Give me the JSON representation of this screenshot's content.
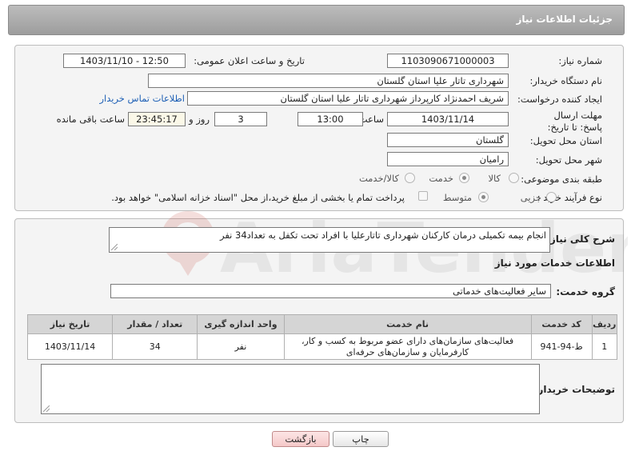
{
  "header": {
    "title": "جزئیات اطلاعات نیاز"
  },
  "form": {
    "need_number": {
      "label": "شماره نیاز:",
      "value": "1103090671000003"
    },
    "announce_datetime": {
      "label": "تاریخ و ساعت اعلان عمومی:",
      "value": "1403/11/10 - 12:50"
    },
    "buyer_org": {
      "label": "نام دستگاه خریدار:",
      "value": "شهرداری تاتار علیا استان گلستان"
    },
    "requester": {
      "label": "ایجاد کننده درخواست:",
      "value": "شریف احمدنژاد کارپرداز شهرداری تاتار علیا استان گلستان",
      "contact_link": "اطلاعات تماس خریدار"
    },
    "deadline": {
      "label": "مهلت ارسال پاسخ: تا تاریخ:",
      "date": "1403/11/14",
      "time_label": "ساعت",
      "time": "13:00",
      "days": "3",
      "days_label": "روز و",
      "remaining": "23:45:17",
      "remaining_label": "ساعت باقی مانده"
    },
    "delivery_province": {
      "label": "استان محل تحویل:",
      "value": "گلستان"
    },
    "delivery_city": {
      "label": "شهر محل تحویل:",
      "value": "رامیان"
    },
    "category": {
      "label": "طبقه بندی موضوعی:",
      "options": [
        "کالا",
        "خدمت",
        "کالا/خدمت"
      ],
      "selected": "خدمت"
    },
    "purchase_type": {
      "label": "نوع فرآیند خرید :",
      "options": [
        "جزیی",
        "متوسط"
      ],
      "selected": "متوسط",
      "checkbox_text": "پرداخت تمام یا بخشی از مبلغ خرید،از محل \"اسناد خزانه اسلامی\" خواهد بود."
    }
  },
  "description": {
    "label": "شرح کلی نیاز:",
    "value": "انجام بیمه تکمیلی درمان کارکنان شهرداری تاتارعلیا با افراد تحت تکفل به تعداد34 نفر"
  },
  "services": {
    "section_title": "اطلاعات خدمات مورد نیاز",
    "group_label": "گروه خدمت:",
    "group_value": "سایر فعالیت‌های خدماتی",
    "columns": [
      "ردیف",
      "کد خدمت",
      "نام خدمت",
      "واحد اندازه گیری",
      "تعداد / مقدار",
      "تاریخ نیاز"
    ],
    "rows": [
      [
        "1",
        "ط-94-941",
        "فعالیت‌های سازمان‌های دارای عضو مربوط به کسب و کار، کارفرمایان و سازمان‌های حرفه‌ای",
        "نفر",
        "34",
        "1403/11/14"
      ]
    ]
  },
  "buyer_notes": {
    "label": "توضیحات خریدار:",
    "value": ""
  },
  "buttons": {
    "print": "چاپ",
    "back": "بازگشت"
  },
  "watermark": {
    "text": "AriaTender.neT"
  }
}
